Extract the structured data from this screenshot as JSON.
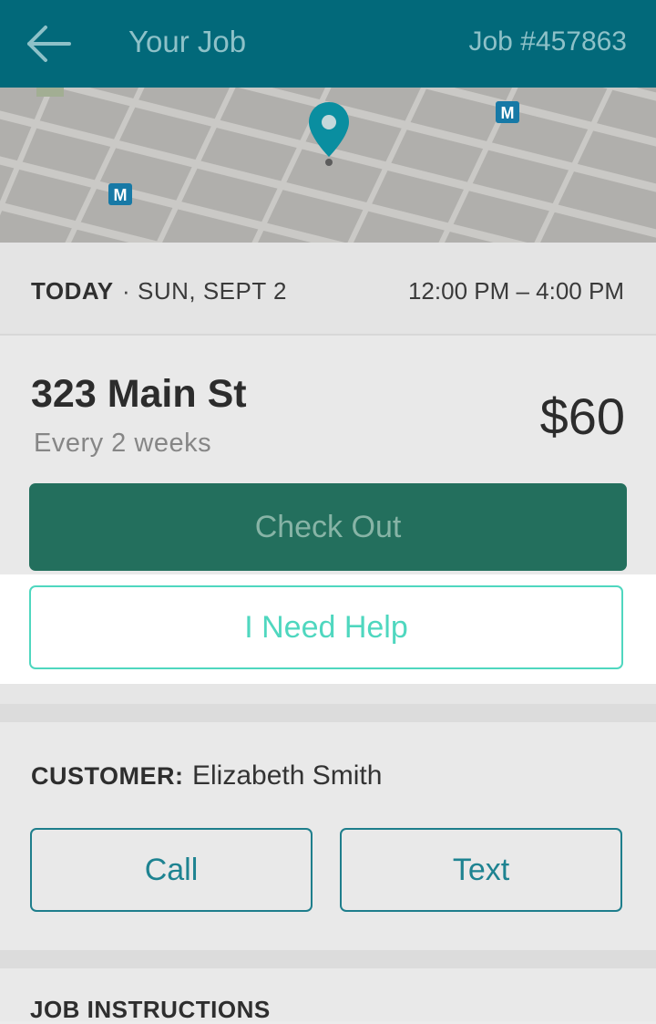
{
  "header": {
    "title": "Your Job",
    "job_number": "Job #457863",
    "back_icon": "arrow-left-icon"
  },
  "map": {
    "pin_icon": "map-pin-icon",
    "metro_label": "M"
  },
  "schedule": {
    "day_label": "TODAY",
    "separator": "·",
    "date": "SUN, SEPT 2",
    "time_range": "12:00 PM – 4:00 PM"
  },
  "job": {
    "address": "323 Main St",
    "frequency": "Every 2 weeks",
    "price": "$60"
  },
  "actions": {
    "check_out_label": "Check Out",
    "help_label": "I Need Help"
  },
  "customer": {
    "label": "CUSTOMER:",
    "name": "Elizabeth Smith",
    "call_label": "Call",
    "text_label": "Text"
  },
  "instructions": {
    "label": "JOB INSTRUCTIONS"
  },
  "colors": {
    "header_bg": "#02697a",
    "checkout_bg": "#236f5d",
    "help_accent": "#4fd7bf",
    "contact_accent": "#1e8391",
    "pin": "#0a8ea0"
  }
}
